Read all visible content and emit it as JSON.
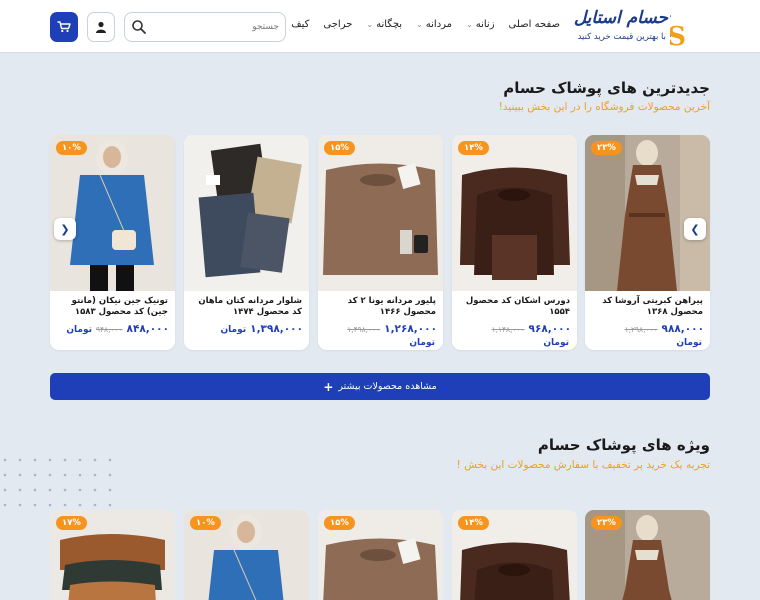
{
  "header": {
    "brand_name": "حسام استایل",
    "brand_slogan": "با بهترین قیمت خرید کنید",
    "nav": [
      {
        "label": "صفحه اصلی",
        "has_menu": false
      },
      {
        "label": "زنانه",
        "has_menu": true
      },
      {
        "label": "مردانه",
        "has_menu": true
      },
      {
        "label": "بچگانه",
        "has_menu": true
      },
      {
        "label": "حراجی",
        "has_menu": false
      },
      {
        "label": "کیف",
        "has_menu": false
      }
    ],
    "search": {
      "placeholder": "جستجو"
    },
    "icons": {
      "search": "search-icon",
      "user": "user-icon",
      "cart": "cart-icon"
    },
    "colors": {
      "accent": "#1e3fb8",
      "brand": "#1b3c8a",
      "highlight": "#f0a019"
    }
  },
  "newest": {
    "title": "جدیدترین های پوشاک حسام",
    "subtitle": "آخرین محصولات فروشگاه را در این بخش ببینید!",
    "products": [
      {
        "title": "پیراهن کبریتی آروشا کد محصول ۱۳۶۸",
        "badge": "۲۳%",
        "old_price": "۱,۲۹۸,۰۰۰",
        "price": "۹۸۸,۰۰۰",
        "currency": "تومان",
        "image": "brown-dress"
      },
      {
        "title": "دورس اشکان کد محصول ۱۵۵۴",
        "badge": "۱۴%",
        "old_price": "۱,۱۴۸,۰۰۰",
        "price": "۹۶۸,۰۰۰",
        "currency": "تومان",
        "image": "dark-brown-sweaters"
      },
      {
        "title": "پلیور مردانه یونا ۲ کد محصول ۱۴۶۶",
        "badge": "۱۵%",
        "old_price": "۱,۴۹۸,۰۰۰",
        "price": "۱,۲۶۸,۰۰۰",
        "currency": "تومان",
        "image": "beige-sweater"
      },
      {
        "title": "شلوار مردانه کتان ماهان کد محصول ۱۴۷۴",
        "badge": "",
        "old_price": "",
        "price": "۱,۳۹۸,۰۰۰",
        "currency": "تومان",
        "image": "folded-pants"
      },
      {
        "title": "تونیک جین نیکان (مانتو جین) کد محصول ۱۵۸۳",
        "badge": "۱۰%",
        "old_price": "۹۴۸,۰۰۰",
        "price": "۸۴۸,۰۰۰",
        "currency": "تومان",
        "image": "blue-tunic"
      }
    ]
  },
  "more_button": {
    "label": "مشاهده محصولات بیشتر",
    "icon": "plus-icon"
  },
  "special": {
    "title": "ویژه های پوشاک حسام",
    "subtitle": "تجربه یک خرید پر تخفیف با سفارش محصولات این بخش !",
    "products": [
      {
        "badge": "۲۳%",
        "image": "brown-dress"
      },
      {
        "badge": "۱۴%",
        "image": "dark-brown-sweaters"
      },
      {
        "badge": "۱۵%",
        "image": "beige-sweater"
      },
      {
        "badge": "۱۰%",
        "image": "blue-tunic"
      },
      {
        "badge": "۱۷%",
        "image": "color-sweaters"
      }
    ]
  }
}
